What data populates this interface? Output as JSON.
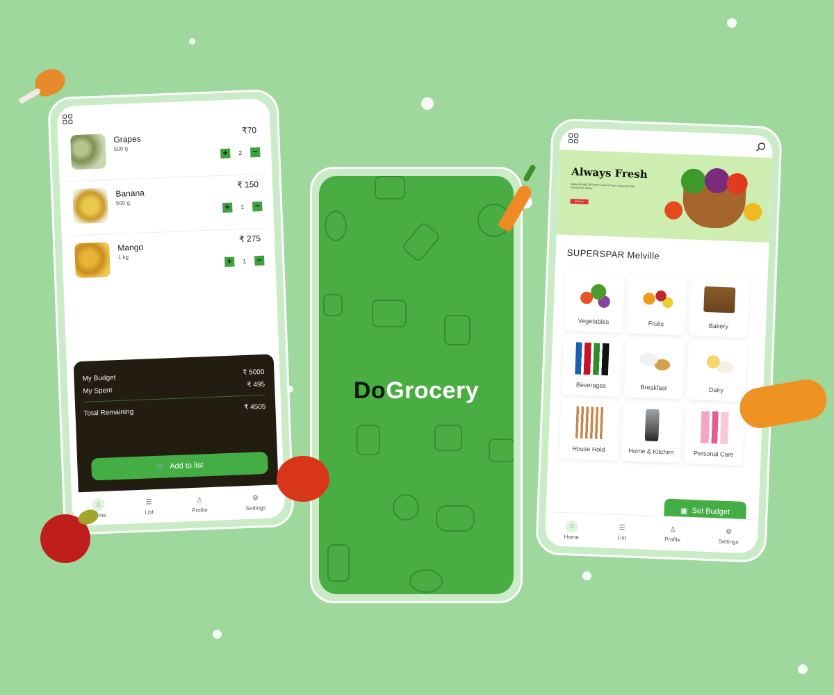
{
  "colors": {
    "bg": "#9fd89c",
    "brand_green": "#44ad44",
    "budget_dark": "#231c10"
  },
  "left": {
    "menu_icon": "grid-menu-icon",
    "items": [
      {
        "name": "Grapes",
        "weight": "500 g",
        "price": "₹70",
        "qty": "2"
      },
      {
        "name": "Banana",
        "weight": "500 g",
        "price": "₹ 150",
        "qty": "1"
      },
      {
        "name": "Mango",
        "weight": "1 kg",
        "price": "₹ 275",
        "qty": "1"
      }
    ],
    "plus": "+",
    "minus": "−",
    "budget": {
      "my_budget_label": "My Budget",
      "my_budget_value": "₹ 5000",
      "my_spent_label": "My Spent",
      "my_spent_value": "₹   495",
      "total_label": "Total Remaining",
      "total_value": "₹ 4505"
    },
    "add_button": "Add to list",
    "nav": [
      "Home",
      "List",
      "Profile",
      "Settings"
    ]
  },
  "center": {
    "brand_do": "Do",
    "brand_grocery": "Grocery"
  },
  "right": {
    "banner_title": "Always Fresh",
    "banner_text": "Daily Arrivals Of Fresh Fruits & Fruits Imported from Around the Globe",
    "banner_button": "Shop Now",
    "store": "SUPERSPAR Melville",
    "categories": [
      "Vegetables",
      "Fruits",
      "Bakery",
      "Beverages",
      "Breakfast",
      "Dairy",
      "House Hold",
      "Home & Kitchen",
      "Personal Care"
    ],
    "set_budget": "Set Budget",
    "nav": [
      "Home",
      "List",
      "Profile",
      "Settings"
    ]
  }
}
